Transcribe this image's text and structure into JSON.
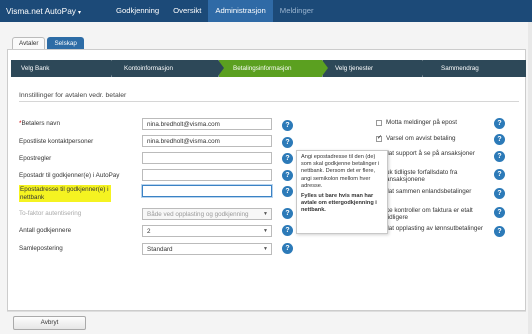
{
  "topnav": {
    "brand": "Visma.net AutoPay",
    "items": [
      {
        "label": "Godkjenning"
      },
      {
        "label": "Oversikt"
      },
      {
        "label": "Administrasjon"
      },
      {
        "label": "Meldinger"
      }
    ]
  },
  "tabs": [
    {
      "label": "Avtaler"
    },
    {
      "label": "Selskap"
    }
  ],
  "wizard": {
    "steps": [
      {
        "label": "Velg Bank"
      },
      {
        "label": "Kontoinformasjon"
      },
      {
        "label": "Betalingsinformasjon"
      },
      {
        "label": "Velg tjenester"
      },
      {
        "label": "Sammendrag"
      }
    ]
  },
  "section": {
    "title": "Innstillinger for avtalen vedr. betaler"
  },
  "form": {
    "betalers_navn_label": "Betalers navn",
    "betalers_navn_req": "*",
    "betalers_navn_value": "nina.bredholt@visma.com",
    "epostliste_label": "Epostliste kontaktpersoner",
    "epostliste_value": "nina.bredholt@visma.com",
    "epostregler_label": "Epostregler",
    "epostregler_value": "",
    "epostadr_autopay_label": "Epostadr til godkjenner(e) i AutoPay",
    "epostadr_autopay_value": "",
    "epostadr_nettbank_label": "Epostadresse til godkjenner(e) i nettbank",
    "epostadr_nettbank_value": "",
    "tofaktor_label": "To-faktor autentisering",
    "tofaktor_value": "Både ved opplasting og godkjenning",
    "antall_label": "Antall godkjennere",
    "antall_value": "2",
    "samlepostering_label": "Samlepostering",
    "samlepostering_value": "Standard",
    "help_icon_glyph": "?"
  },
  "tooltip": {
    "text1": "Angi epostadresse til den (de) som skal godkjenne betalinger i nettbank. Dersom det er flere, angi semikolon mellom hver adresse.",
    "text2": "Fylles ut bare hvis man har avtale om ettergodkjenning i nettbank."
  },
  "right_options": [
    {
      "label": "Motta meldinger på epost",
      "checked": false
    },
    {
      "label": "Varsel om avvist betaling",
      "checked": true
    },
    {
      "label": "llat support å se på ansaksjoner"
    },
    {
      "label": "uk tidligste forfallsdato fra ansaksjonene"
    },
    {
      "label": "llat sammen enlandsbetalinger"
    },
    {
      "label": "ke kontroller om faktura er etalt tidligere"
    },
    {
      "label": "llat opplasting av lønnsutbetalinger"
    }
  ],
  "footer": {
    "cancel_label": "Avbryt"
  },
  "colors": {
    "nav_bg": "#1c4a78",
    "nav_active": "#2f6aa6",
    "wizard_bg": "#2d4858",
    "wizard_active": "#5ba020",
    "help_icon": "#2c7ab8",
    "highlight": "#f5f321"
  }
}
